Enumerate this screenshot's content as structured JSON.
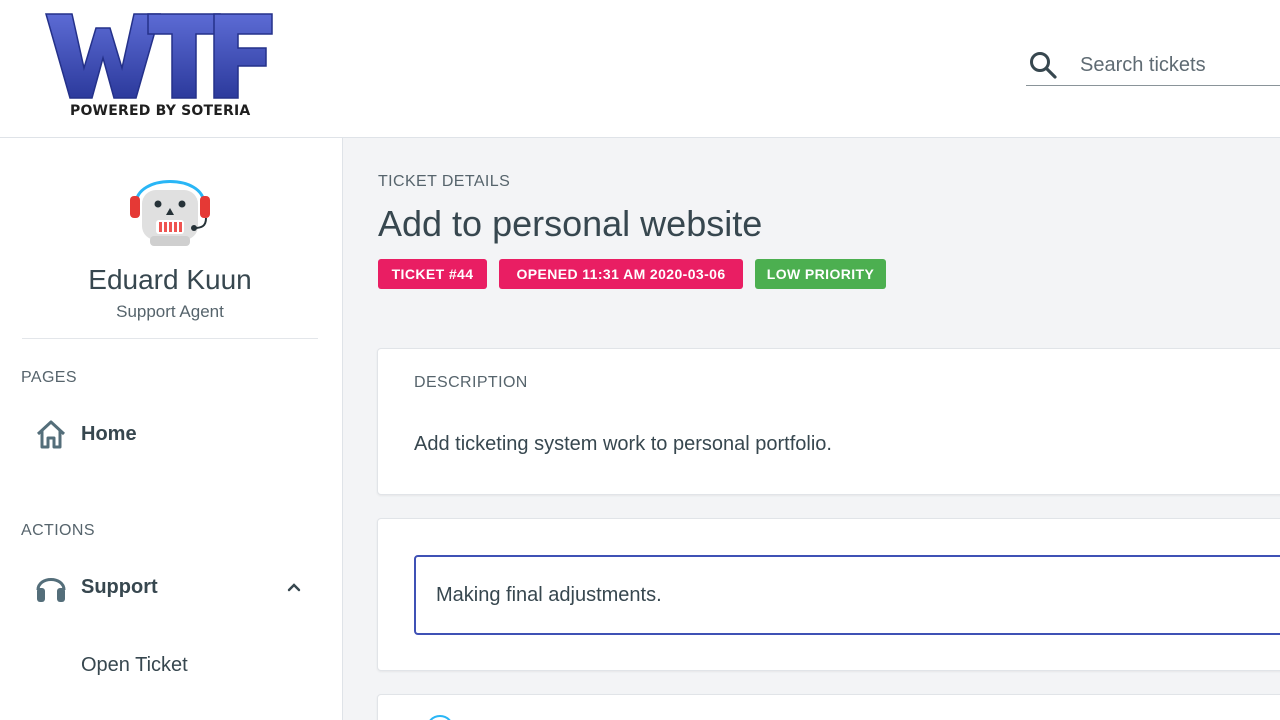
{
  "logo": {
    "letters": "WTF",
    "tagline": "POWERED BY SOTERIA"
  },
  "search": {
    "placeholder": "Search tickets",
    "icon": "search-icon"
  },
  "user": {
    "name": "Eduard Kuun",
    "role": "Support Agent"
  },
  "sidebar": {
    "pages_title": "PAGES",
    "pages": [
      {
        "label": "Home",
        "icon": "home-icon"
      }
    ],
    "actions_title": "ACTIONS",
    "actions": [
      {
        "label": "Support",
        "icon": "headset-icon",
        "expanded": true,
        "children": [
          {
            "label": "Open Ticket"
          }
        ]
      }
    ]
  },
  "ticket": {
    "eyebrow": "TICKET DETAILS",
    "title": "Add to personal website",
    "badges": [
      {
        "text": "TICKET #44",
        "color": "#e91e63"
      },
      {
        "text": "OPENED 11:31 AM 2020-03-06",
        "color": "#e91e63"
      },
      {
        "text": "LOW PRIORITY",
        "color": "#4caf50"
      }
    ],
    "description_label": "DESCRIPTION",
    "description": "Add ticketing system work to personal portfolio.",
    "status_text": "Making final adjustments."
  },
  "colors": {
    "accent": "#3f51b5",
    "pink": "#e91e63",
    "green": "#4caf50",
    "logo_blue": "#3949ab"
  }
}
